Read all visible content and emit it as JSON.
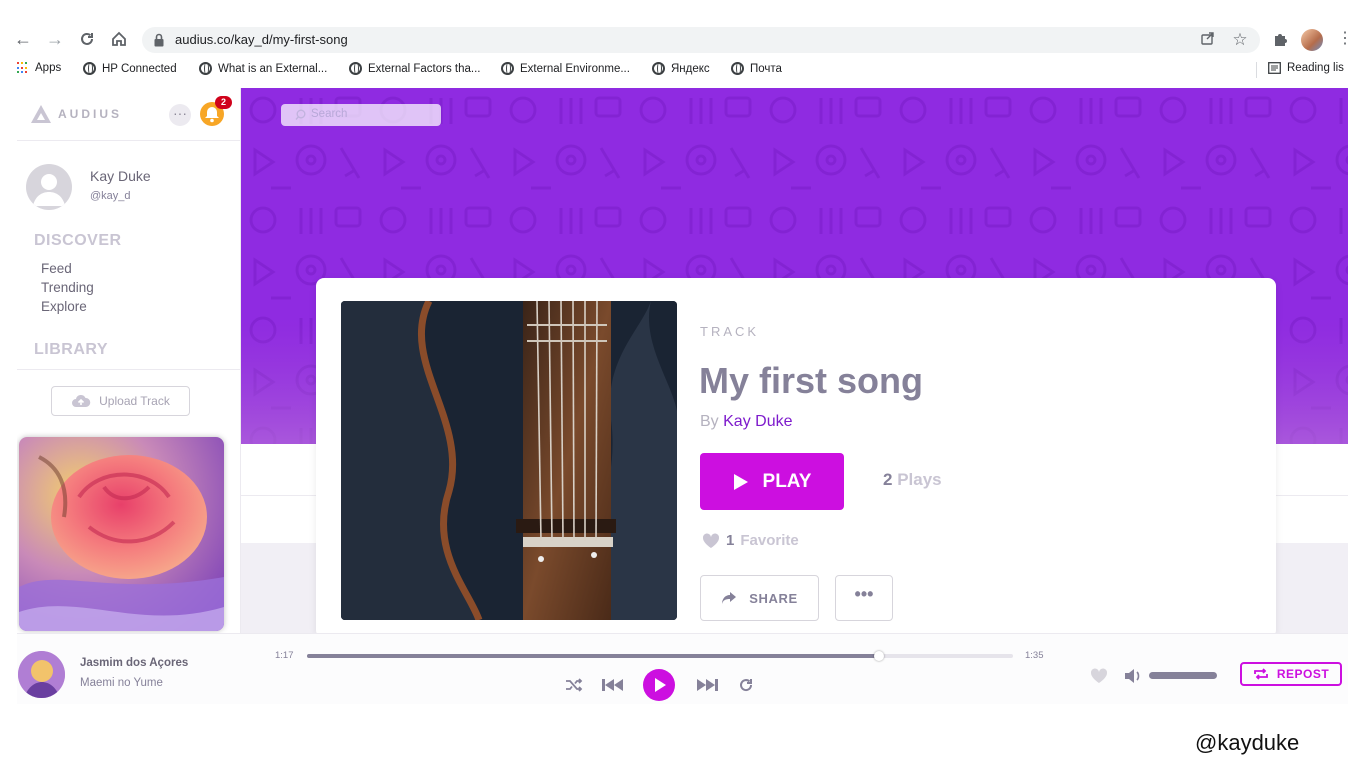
{
  "browser": {
    "url": "audius.co/kay_d/my-first-song",
    "bookmarks": [
      {
        "label": "Apps"
      },
      {
        "label": "HP Connected"
      },
      {
        "label": "What is an External..."
      },
      {
        "label": "External Factors tha..."
      },
      {
        "label": "External Environme..."
      },
      {
        "label": "Яндекс"
      },
      {
        "label": "Почта"
      }
    ],
    "reading_list": "Reading lis"
  },
  "sidebar": {
    "logo": "AUDIUS",
    "notification_count": "2",
    "user": {
      "name": "Kay Duke",
      "handle": "@kay_d"
    },
    "discover_heading": "DISCOVER",
    "discover_items": [
      {
        "label": "Feed"
      },
      {
        "label": "Trending"
      },
      {
        "label": "Explore"
      }
    ],
    "library_heading": "LIBRARY",
    "upload_label": "Upload Track"
  },
  "header": {
    "search_placeholder": "Search"
  },
  "track": {
    "type_label": "TRACK",
    "title": "My first song",
    "by_prefix": "By",
    "artist": "Kay Duke",
    "play_label": "PLAY",
    "plays_count": "2",
    "plays_label": "Plays",
    "favorites_count": "1",
    "favorites_label": "Favorite",
    "share_label": "SHARE",
    "more_label": "•••"
  },
  "player": {
    "title": "Jasmim dos Açores",
    "artist": "Maemi no Yume",
    "elapsed": "1:17",
    "duration": "1:35",
    "progress_fraction": 0.81,
    "volume_fraction": 1.0,
    "repost_label": "REPOST"
  },
  "icons": {
    "back": "back-arrow-icon",
    "forward": "forward-arrow-icon",
    "reload": "reload-icon",
    "home": "home-icon",
    "lock": "lock-icon",
    "share_page": "share-page-icon",
    "star": "bookmark-star-icon",
    "extensions": "puzzle-icon",
    "menu": "kebab-menu-icon",
    "bell": "bell-icon",
    "cloud": "cloud-upload-icon",
    "shuffle": "shuffle-icon",
    "prev": "previous-track-icon",
    "next": "next-track-icon",
    "repeat": "repeat-icon",
    "heart": "heart-icon",
    "volume": "volume-icon"
  },
  "colors": {
    "brand_purple": "#7e1bcc",
    "hero_purple": "#8f2be1",
    "accent_magenta": "#cc0fe0",
    "text_gray": "#858199"
  },
  "watermark": "@kayduke"
}
